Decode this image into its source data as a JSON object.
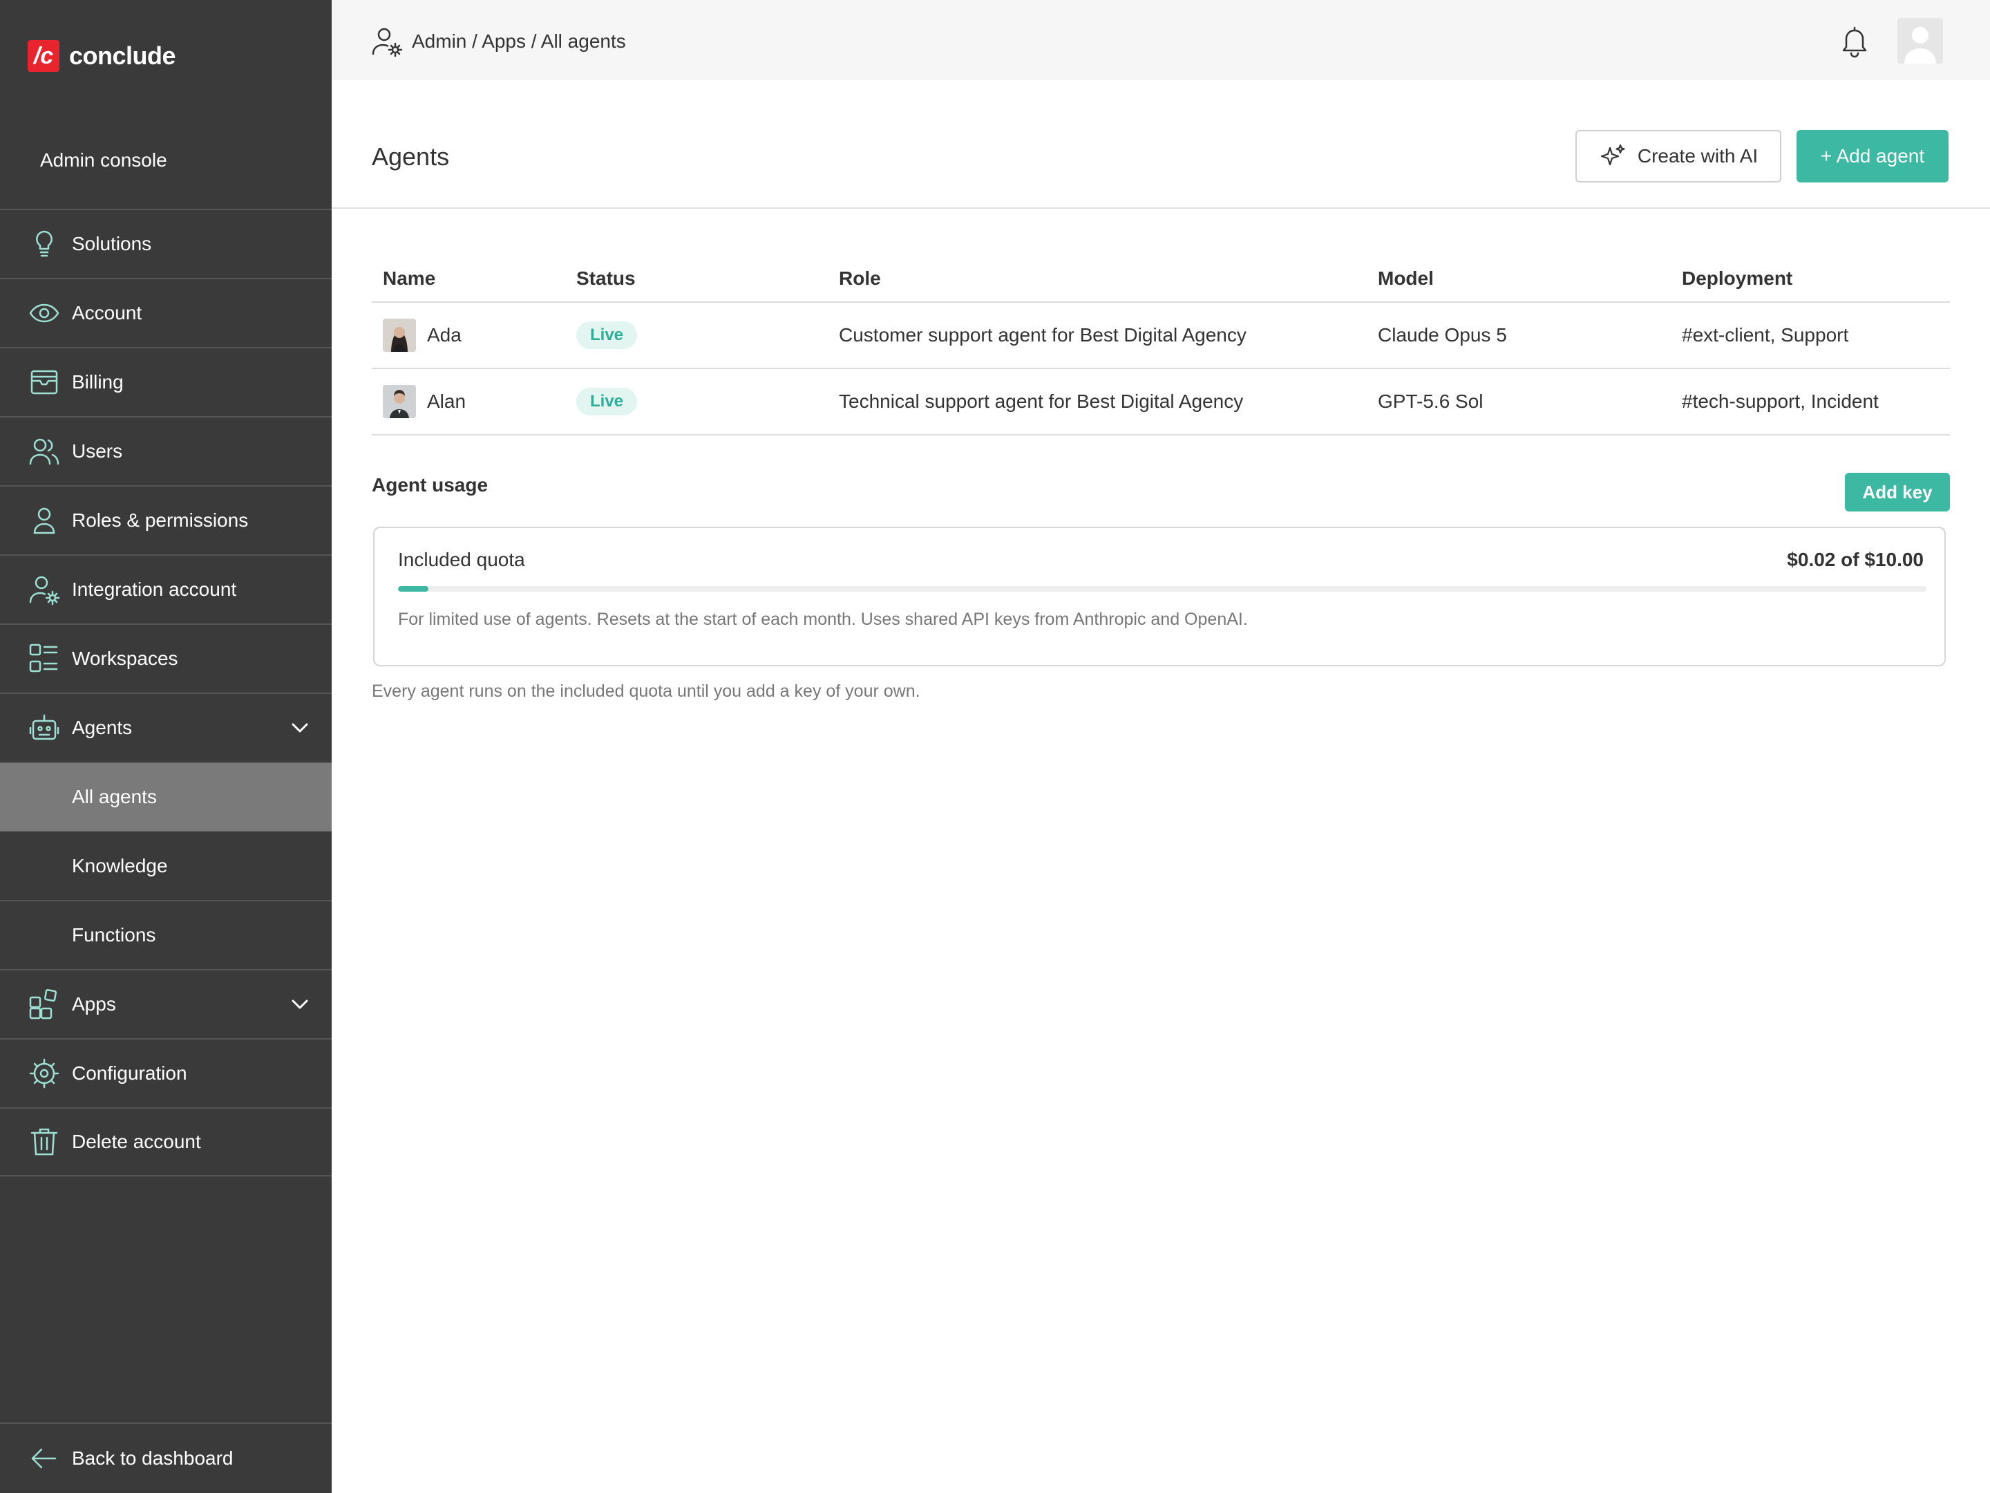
{
  "brand": {
    "mark": "/c",
    "name": "conclude"
  },
  "sidebar": {
    "console_label": "Admin console",
    "items": [
      {
        "label": "Solutions",
        "icon": "lightbulb-icon"
      },
      {
        "label": "Account",
        "icon": "eye-icon"
      },
      {
        "label": "Billing",
        "icon": "billing-icon"
      },
      {
        "label": "Users",
        "icon": "users-icon"
      },
      {
        "label": "Roles & permissions",
        "icon": "user-icon"
      },
      {
        "label": "Integration account",
        "icon": "user-gear-icon"
      },
      {
        "label": "Workspaces",
        "icon": "workspaces-icon"
      },
      {
        "label": "Agents",
        "icon": "robot-icon"
      },
      {
        "label": "All agents"
      },
      {
        "label": "Knowledge"
      },
      {
        "label": "Functions"
      },
      {
        "label": "Apps",
        "icon": "apps-icon"
      },
      {
        "label": "Configuration",
        "icon": "gear-icon"
      },
      {
        "label": "Delete account",
        "icon": "trash-icon"
      }
    ],
    "back_label": "Back to dashboard"
  },
  "topbar": {
    "breadcrumb": "Admin / Apps / All agents"
  },
  "page": {
    "title": "Agents",
    "create_ai_label": "Create with AI",
    "add_agent_label": "+ Add agent"
  },
  "table": {
    "headers": {
      "name": "Name",
      "status": "Status",
      "role": "Role",
      "model": "Model",
      "deployment": "Deployment"
    },
    "rows": [
      {
        "name": "Ada",
        "status": "Live",
        "role": "Customer support agent for Best Digital Agency",
        "model": "Claude Opus 5",
        "deployment": "#ext-client, Support"
      },
      {
        "name": "Alan",
        "status": "Live",
        "role": "Technical support agent for Best Digital Agency",
        "model": "GPT-5.6 Sol",
        "deployment": "#tech-support, Incident"
      }
    ]
  },
  "usage": {
    "title": "Agent usage",
    "add_key_label": "Add key",
    "quota_label": "Included quota",
    "quota_value": "$0.02 of $10.00",
    "quota_fraction": 0.02,
    "quota_note": "For limited use of agents. Resets at the start of each month. Uses shared API keys from Anthropic and OpenAI.",
    "footnote": "Every agent runs on the included quota until you add a key of your own."
  },
  "colors": {
    "accent": "#3cb8a3",
    "brand": "#e8252f",
    "sidebar": "#3a3a3a",
    "active": "#7a7a7a"
  }
}
